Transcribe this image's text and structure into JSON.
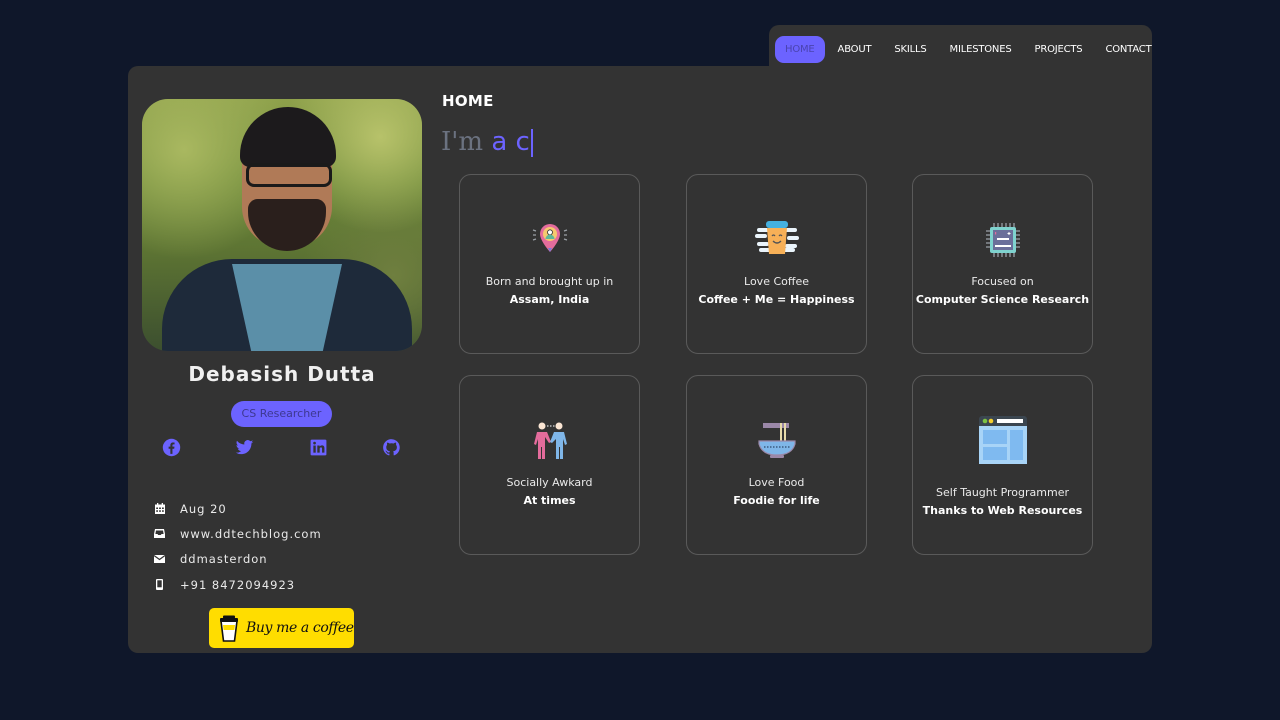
{
  "nav": {
    "items": [
      {
        "label": "HOME",
        "active": true
      },
      {
        "label": "ABOUT",
        "active": false
      },
      {
        "label": "SKILLS",
        "active": false
      },
      {
        "label": "MILESTONES",
        "active": false
      },
      {
        "label": "PROJECTS",
        "active": false
      },
      {
        "label": "CONTACT",
        "active": false
      }
    ]
  },
  "profile": {
    "name": "Debasish Dutta",
    "role": "CS Researcher",
    "socials": [
      "facebook-icon",
      "twitter-icon",
      "linkedin-icon",
      "github-icon"
    ],
    "info": [
      {
        "icon": "calendar-icon",
        "text": "Aug 20"
      },
      {
        "icon": "inbox-icon",
        "text": "www.ddtechblog.com"
      },
      {
        "icon": "envelope-icon",
        "text": "ddmasterdon"
      },
      {
        "icon": "mobile-phone-icon",
        "text": "+91 8472094923"
      }
    ],
    "coffee_button": "Buy me a coffee"
  },
  "main": {
    "section_title": "HOME",
    "typed_prefix": "I'm",
    "typed_accent": " a c",
    "tiles": [
      {
        "icon": "location-pin-icon",
        "line1": "Born and brought up in",
        "line2": "Assam, India"
      },
      {
        "icon": "coffee-cup-icon",
        "line1": "Love Coffee",
        "line2": "Coffee + Me = Happiness"
      },
      {
        "icon": "cpu-chip-icon",
        "line1": "Focused on",
        "line2": "Computer Science Research"
      },
      {
        "icon": "handshake-icon",
        "line1": "Socially Awkard",
        "line2": "At times"
      },
      {
        "icon": "noodle-bowl-icon",
        "line1": "Love Food",
        "line2": "Foodie for life"
      },
      {
        "icon": "browser-window-icon",
        "line1": "Self Taught Programmer",
        "line2": "Thanks to Web Resources"
      }
    ]
  },
  "colors": {
    "accent": "#6c63ff",
    "background": "#0f172a",
    "card": "#333333",
    "coffee_yellow": "#ffdd00"
  }
}
